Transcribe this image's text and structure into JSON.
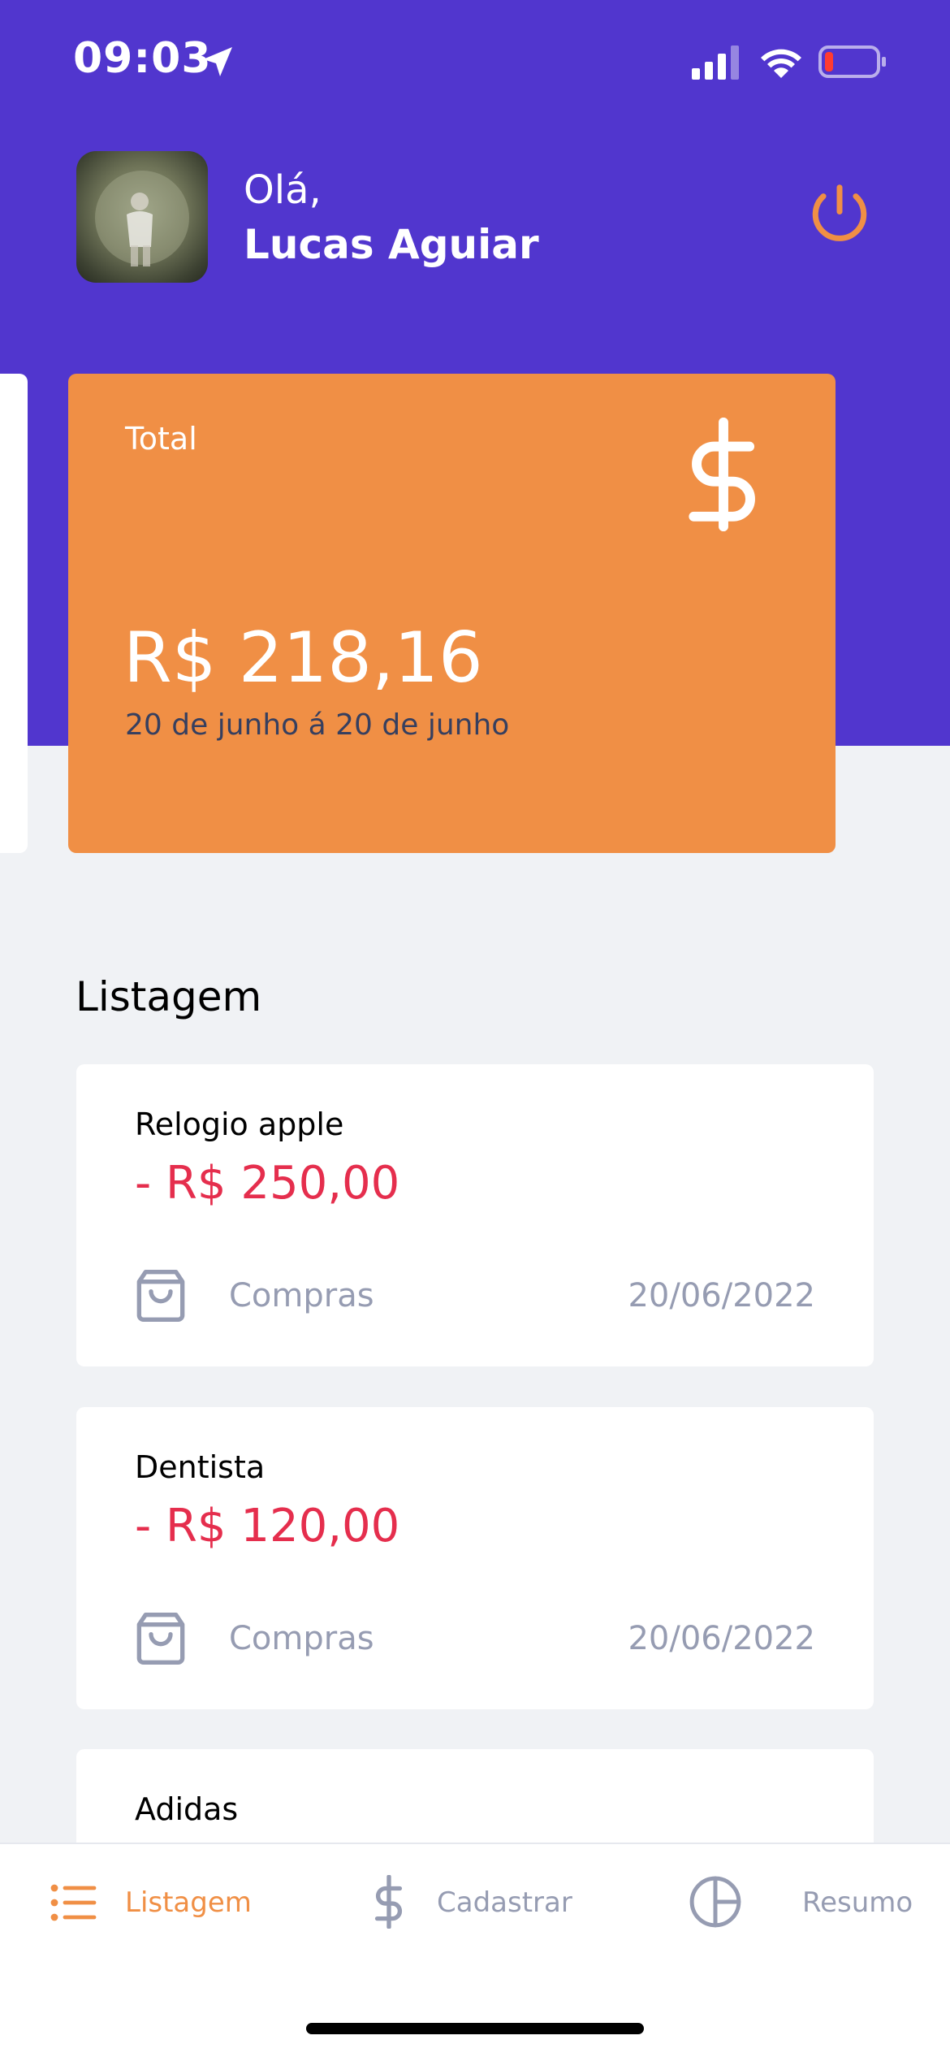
{
  "status_bar": {
    "time": "09:03"
  },
  "user": {
    "greeting": "Olá,",
    "name": "Lucas Aguiar"
  },
  "summary_card": {
    "label": "Total",
    "amount": "R$ 218,16",
    "period": "20 de junho á 20 de junho",
    "icon": "dollar-icon"
  },
  "listing": {
    "title": "Listagem",
    "transactions": [
      {
        "title": "Relogio apple",
        "amount": "- R$ 250,00",
        "category": "Compras",
        "category_icon": "shopping-bag-icon",
        "date": "20/06/2022"
      },
      {
        "title": "Dentista",
        "amount": "- R$ 120,00",
        "category": "Compras",
        "category_icon": "shopping-bag-icon",
        "date": "20/06/2022"
      },
      {
        "title": "Adidas"
      }
    ]
  },
  "tabbar": {
    "tabs": [
      {
        "label": "Listagem",
        "icon": "list-icon",
        "active": true
      },
      {
        "label": "Cadastrar",
        "icon": "dollar-sign-icon",
        "active": false
      },
      {
        "label": "Resumo",
        "icon": "pie-chart-icon",
        "active": false
      }
    ]
  },
  "colors": {
    "header": "#5136CE",
    "accent": "#F08F45",
    "negative": "#E52E4D",
    "muted": "#969CB2",
    "background": "#F0F2F5"
  }
}
